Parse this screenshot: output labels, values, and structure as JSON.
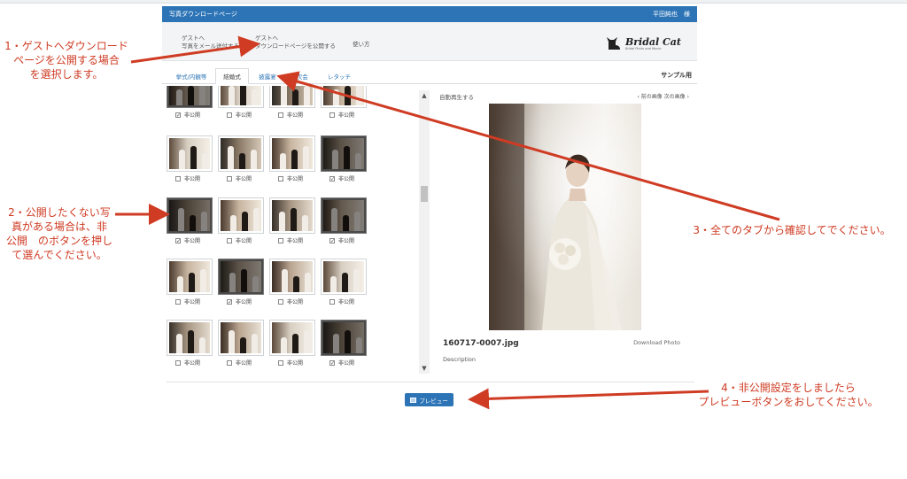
{
  "header": {
    "title": "写真ダウンロードページ",
    "user": "平田純也　様"
  },
  "guest": {
    "option_a": [
      "ゲストへ",
      "写真をメール送付する"
    ],
    "option_b": [
      "ゲストへ",
      "ダウンロードページを公開する"
    ],
    "howto": "使い方"
  },
  "brand": {
    "name": "Bridal Cat",
    "tagline": "Bridal Photo and Movie"
  },
  "tabs": [
    {
      "label": "挙式/内観等",
      "active": false
    },
    {
      "label": "結婚式",
      "active": true
    },
    {
      "label": "披露宴",
      "active": false
    },
    {
      "label": "二次会",
      "active": false
    },
    {
      "label": "レタッチ",
      "active": false
    }
  ],
  "tabs_right_label": "サンプル用",
  "grid": {
    "checkbox_label": "非公開",
    "rows": [
      [
        {
          "checked": true,
          "dark": true
        },
        {
          "checked": false,
          "dark": false
        },
        {
          "checked": false,
          "dark": false
        },
        {
          "checked": false,
          "dark": false
        }
      ],
      [
        {
          "checked": false,
          "dark": false
        },
        {
          "checked": false,
          "dark": false
        },
        {
          "checked": false,
          "dark": false
        },
        {
          "checked": true,
          "dark": true
        }
      ],
      [
        {
          "checked": true,
          "dark": true
        },
        {
          "checked": false,
          "dark": false
        },
        {
          "checked": false,
          "dark": false
        },
        {
          "checked": true,
          "dark": true
        }
      ],
      [
        {
          "checked": false,
          "dark": false
        },
        {
          "checked": true,
          "dark": true
        },
        {
          "checked": false,
          "dark": false
        },
        {
          "checked": false,
          "dark": false
        }
      ],
      [
        {
          "checked": false,
          "dark": false
        },
        {
          "checked": false,
          "dark": false
        },
        {
          "checked": false,
          "dark": false
        },
        {
          "checked": true,
          "dark": true
        }
      ]
    ]
  },
  "viewer": {
    "autoplay": "自動再生する",
    "prev_next": "‹ 前の画像  次の画像 ›",
    "filename": "160717-0007.jpg",
    "download": "Download Photo",
    "description_label": "Description"
  },
  "preview_button": "プレビュー",
  "annotations": {
    "note1": [
      "1・ゲストへダウンロード",
      "ページを公開する場合",
      "を選択します。"
    ],
    "note2": [
      "2・公開したくない写",
      "真がある場合は、非",
      "公開　のボタンを押し",
      "て選んでください。"
    ],
    "note3": "3・全てのタブから確認してでください。",
    "note4": [
      "4・非公開設定をしましたら",
      "プレビューボタンをおしてください。"
    ]
  },
  "colors": {
    "header_blue": "#2c74b6",
    "annotation_red": "#cf3b23"
  }
}
